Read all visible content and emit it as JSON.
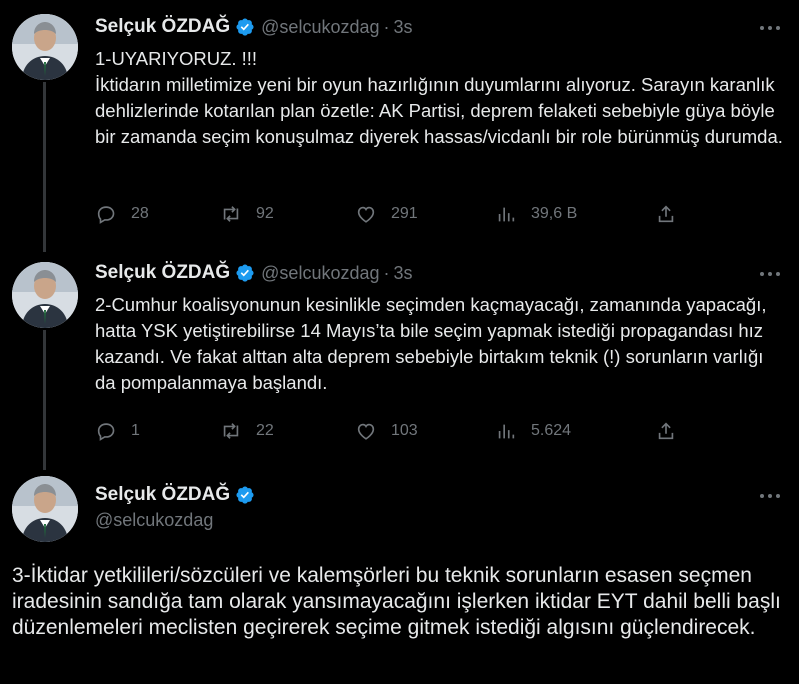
{
  "author": {
    "name": "Selçuk ÖZDAĞ",
    "handle": "@selcukozdag"
  },
  "colors": {
    "background": "#000000",
    "text": "#e7e9ea",
    "muted": "#71767b",
    "verified": "#1d9bf0"
  },
  "tweets": [
    {
      "time": "3s",
      "text": "1-UYARIYORUZ. !!!\nİktidarın milletimize yeni bir oyun hazırlığının duyumlarını alıyoruz. Sarayın karanlık dehlizlerinde kotarılan plan özetle: AK Partisi, deprem felaketi sebebiyle güya böyle bir  zamanda seçim konuşulmaz diyerek hassas/vicdanlı bir role bürünmüş durumda.",
      "replies": "28",
      "retweets": "92",
      "likes": "291",
      "views": "39,6 B"
    },
    {
      "time": "3s",
      "text": "2-Cumhur koalisyonunun kesinlikle seçimden kaçmayacağı, zamanında yapacağı, hatta YSK yetiştirebilirse 14 Mayıs’ta bile seçim yapmak istediği propagandası hız kazandı. Ve fakat alttan alta deprem sebebiyle birtakım teknik (!) sorunların varlığı da pompalanmaya başlandı.",
      "replies": "1",
      "retweets": "22",
      "likes": "103",
      "views": "5.624"
    },
    {
      "text": "3-İktidar yetkilileri/sözcüleri ve  kalemşörleri bu teknik sorunların esasen seçmen iradesinin sandığa tam olarak yansımayacağını işlerken iktidar EYT dahil belli başlı düzenlemeleri meclisten geçirerek seçime gitmek istediği algısını güçlendirecek."
    }
  ],
  "icons": [
    "verified-badge-icon",
    "more-icon",
    "reply-icon",
    "retweet-icon",
    "like-icon",
    "views-icon",
    "share-icon"
  ]
}
